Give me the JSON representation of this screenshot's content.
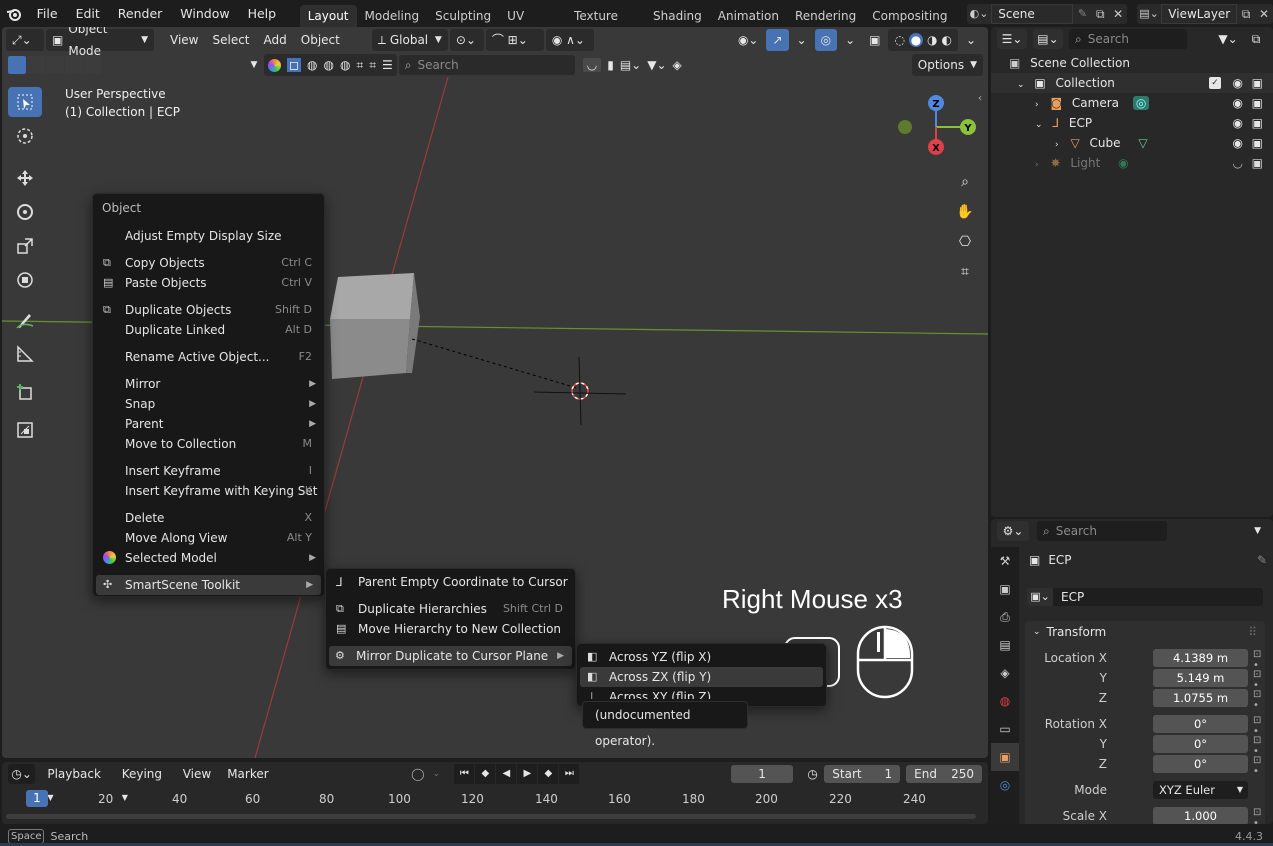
{
  "topbar": {
    "menus": [
      "File",
      "Edit",
      "Render",
      "Window",
      "Help"
    ],
    "workspaces": [
      "Layout",
      "Modeling",
      "Sculpting",
      "UV Editing",
      "Texture Paint",
      "Shading",
      "Animation",
      "Rendering",
      "Compositing"
    ],
    "scene": "Scene",
    "view_layer": "ViewLayer"
  },
  "viewport": {
    "mode": "Object Mode",
    "menus": [
      "View",
      "Select",
      "Add",
      "Object"
    ],
    "orientation": "Global",
    "search_placeholder": "Search",
    "options_label": "Options",
    "info_line1": "User Perspective",
    "info_line2": "(1) Collection | ECP",
    "gizmo": {
      "z": "Z",
      "y": "Y",
      "x": "X"
    },
    "overlay_text": "Right Mouse x3"
  },
  "context_menu": {
    "title": "Object",
    "items": [
      {
        "label": "Adjust Empty Display Size",
        "shortcut": ""
      },
      {
        "label": "Copy Objects",
        "shortcut": "Ctrl C"
      },
      {
        "label": "Paste Objects",
        "shortcut": "Ctrl V"
      },
      {
        "label": "Duplicate Objects",
        "shortcut": "Shift D"
      },
      {
        "label": "Duplicate Linked",
        "shortcut": "Alt D"
      },
      {
        "label": "Rename Active Object...",
        "shortcut": "F2"
      },
      {
        "label": "Mirror",
        "shortcut": ""
      },
      {
        "label": "Snap",
        "shortcut": ""
      },
      {
        "label": "Parent",
        "shortcut": ""
      },
      {
        "label": "Move to Collection",
        "shortcut": "M"
      },
      {
        "label": "Insert Keyframe",
        "shortcut": "I"
      },
      {
        "label": "Insert Keyframe with Keying Set",
        "shortcut": "K"
      },
      {
        "label": "Delete",
        "shortcut": "X"
      },
      {
        "label": "Move Along View",
        "shortcut": "Alt Y"
      },
      {
        "label": "Selected Model",
        "shortcut": ""
      },
      {
        "label": "SmartScene Toolkit",
        "shortcut": ""
      }
    ]
  },
  "submenu": {
    "items": [
      {
        "label": "Parent Empty Coordinate to Cursor",
        "shortcut": ""
      },
      {
        "label": "Duplicate Hierarchies",
        "shortcut": "Shift Ctrl D"
      },
      {
        "label": "Move Hierarchy to New Collection",
        "shortcut": ""
      },
      {
        "label": "Mirror Duplicate to Cursor Plane",
        "shortcut": ""
      }
    ]
  },
  "submenu2": {
    "items": [
      "Across YZ (flip X)",
      "Across ZX (flip Y)",
      "Across XY (flip Z)"
    ],
    "tooltip": "(undocumented operator)."
  },
  "outliner": {
    "search_placeholder": "Search",
    "root": "Scene Collection",
    "rows": [
      "Collection",
      "Camera",
      "ECP",
      "Cube",
      "Light"
    ]
  },
  "properties": {
    "search_placeholder": "Search",
    "object_name": "ECP",
    "object_field": "ECP",
    "panel": "Transform",
    "location_label": "Location X",
    "location": [
      "4.1389 m",
      "5.149 m",
      "1.0755 m"
    ],
    "rotation_label": "Rotation X",
    "rotation": [
      "0°",
      "0°",
      "0°"
    ],
    "axis_y": "Y",
    "axis_z": "Z",
    "mode_label": "Mode",
    "mode_value": "XYZ Euler",
    "scale_label": "Scale X",
    "scale_x": "1.000"
  },
  "timeline": {
    "menus": [
      "Playback",
      "Keying",
      "View",
      "Marker"
    ],
    "current_frame": "1",
    "start_label": "Start",
    "start": "1",
    "end_label": "End",
    "end": "250",
    "ticks": [
      "20",
      "40",
      "60",
      "80",
      "100",
      "120",
      "140",
      "160",
      "180",
      "200",
      "220",
      "240"
    ],
    "playhead": "1"
  },
  "statusbar": {
    "key": "Space",
    "action": "Search",
    "version": "4.4.3"
  }
}
